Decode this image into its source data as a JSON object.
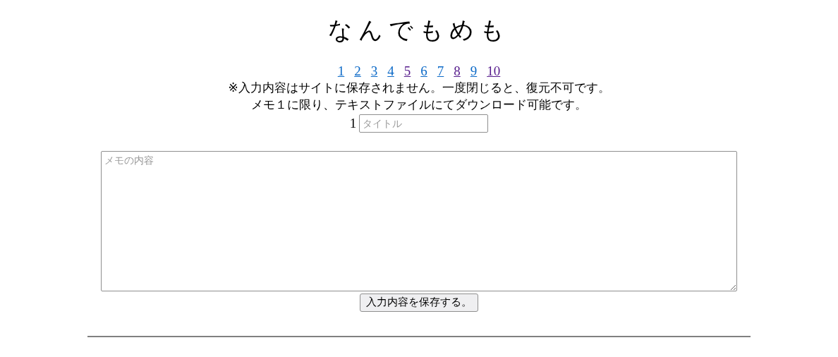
{
  "title": "なんでもめも",
  "memo_links": [
    {
      "label": "1",
      "visited": false
    },
    {
      "label": "2",
      "visited": false
    },
    {
      "label": "3",
      "visited": false
    },
    {
      "label": "4",
      "visited": false
    },
    {
      "label": "5",
      "visited": true
    },
    {
      "label": "6",
      "visited": false
    },
    {
      "label": "7",
      "visited": false
    },
    {
      "label": "8",
      "visited": true
    },
    {
      "label": "9",
      "visited": false
    },
    {
      "label": "10",
      "visited": true
    }
  ],
  "notices": [
    "※入力内容はサイトに保存されません。一度閉じると、復元不可です。",
    "メモ１に限り、テキストファイルにてダウンロード可能です。"
  ],
  "memo_number": "1",
  "title_field": {
    "placeholder": "タイトル"
  },
  "content_field": {
    "placeholder": "メモの内容"
  },
  "save_button": "入力内容を保存する。"
}
